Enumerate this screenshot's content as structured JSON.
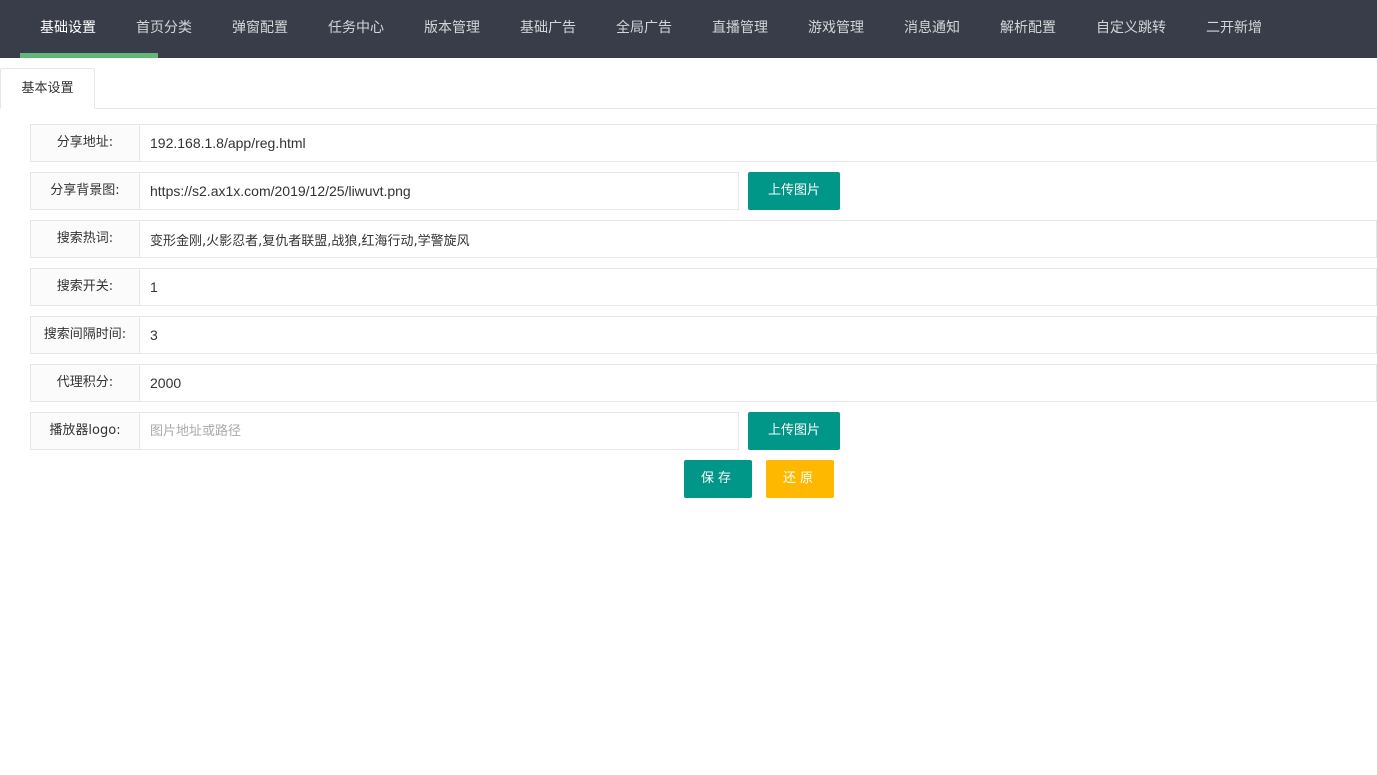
{
  "nav": {
    "items": [
      "基础设置",
      "首页分类",
      "弹窗配置",
      "任务中心",
      "版本管理",
      "基础广告",
      "全局广告",
      "直播管理",
      "游戏管理",
      "消息通知",
      "解析配置",
      "自定义跳转",
      "二开新增"
    ],
    "active_index": 0
  },
  "tab": {
    "label": "基本设置"
  },
  "form": {
    "share_url": {
      "label": "分享地址:",
      "value": "192.168.1.8/app/reg.html"
    },
    "share_bg": {
      "label": "分享背景图:",
      "value": "https://s2.ax1x.com/2019/12/25/liwuvt.png",
      "upload_label": "上传图片"
    },
    "search_hot": {
      "label": "搜索热词:",
      "value": "变形金刚,火影忍者,复仇者联盟,战狼,红海行动,学警旋风"
    },
    "search_switch": {
      "label": "搜索开关:",
      "value": "1"
    },
    "search_interval": {
      "label": "搜索间隔时间:",
      "value": "3"
    },
    "agent_points": {
      "label": "代理积分:",
      "value": "2000"
    },
    "player_logo": {
      "label": "播放器logo:",
      "value": "",
      "placeholder": "图片地址或路径",
      "upload_label": "上传图片"
    }
  },
  "actions": {
    "save_label": "保存",
    "reset_label": "还原"
  },
  "colors": {
    "nav_bg": "#393d49",
    "nav_active_bar": "#5fb878",
    "primary": "#009688",
    "warm": "#ffb800"
  }
}
